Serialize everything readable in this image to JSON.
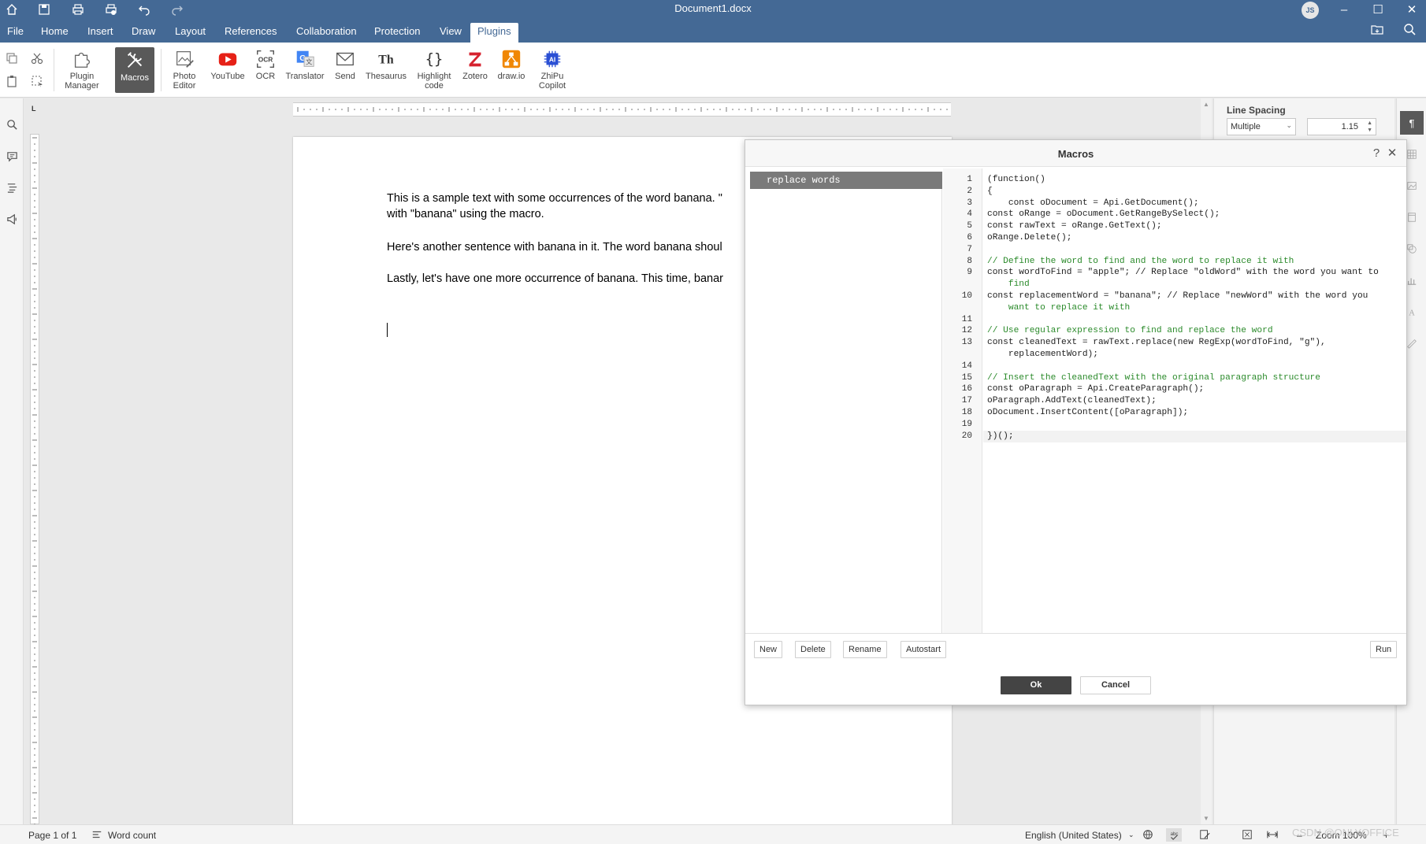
{
  "title_bar": {
    "document_title": "Document1.docx",
    "user_initials": "JS",
    "icons": [
      "home-icon",
      "save-icon",
      "print-icon",
      "quick-print-icon",
      "undo-icon",
      "redo-icon"
    ]
  },
  "menu": {
    "tabs": [
      "File",
      "Home",
      "Insert",
      "Draw",
      "Layout",
      "References",
      "Collaboration",
      "Protection",
      "View",
      "Plugins"
    ],
    "active_tab": "Plugins"
  },
  "toolbar": {
    "plugin_manager": "Plugin Manager",
    "macros": "Macros",
    "photo_editor": "Photo Editor",
    "youtube": "YouTube",
    "ocr": "OCR",
    "translator": "Translator",
    "send": "Send",
    "thesaurus": "Thesaurus",
    "highlight_code": "Highlight code",
    "zotero": "Zotero",
    "drawio": "draw.io",
    "zhipu_copilot": "ZhiPu Copilot"
  },
  "document": {
    "paragraphs": [
      "This is a sample text with some occurrences of the word  banana. \"",
      "with \"banana\" using the macro.",
      "Here's another sentence with banana in it. The word banana shoul",
      "Lastly, let's have one more occurrence of banana. This time, banar"
    ]
  },
  "right_panel": {
    "line_spacing_label": "Line Spacing",
    "line_spacing_mode": "Multiple",
    "line_spacing_value": "1.15"
  },
  "dialog": {
    "title": "Macros",
    "help_glyph": "?",
    "close_glyph": "✕",
    "macros": [
      "replace words"
    ],
    "code_lines": [
      {
        "n": "1",
        "text": "(function()",
        "type": "code"
      },
      {
        "n": "2",
        "text": "{",
        "type": "code"
      },
      {
        "n": "3",
        "text": "    const oDocument = Api.GetDocument();",
        "type": "code"
      },
      {
        "n": "4",
        "text": "const oRange = oDocument.GetRangeBySelect();",
        "type": "code"
      },
      {
        "n": "5",
        "text": "const rawText = oRange.GetText();",
        "type": "code"
      },
      {
        "n": "6",
        "text": "oRange.Delete();",
        "type": "code"
      },
      {
        "n": "7",
        "text": "",
        "type": "code"
      },
      {
        "n": "8",
        "text": "// Define the word to find and the word to replace it with",
        "type": "comment"
      },
      {
        "n": "9",
        "text": "const wordToFind = \"apple\"; // Replace \"oldWord\" with the word you want to",
        "type": "code"
      },
      {
        "n": "",
        "text": "    find",
        "type": "comment"
      },
      {
        "n": "10",
        "text": "const replacementWord = \"banana\"; // Replace \"newWord\" with the word you",
        "type": "code"
      },
      {
        "n": "",
        "text": "    want to replace it with",
        "type": "comment"
      },
      {
        "n": "11",
        "text": "",
        "type": "code"
      },
      {
        "n": "12",
        "text": "// Use regular expression to find and replace the word",
        "type": "comment"
      },
      {
        "n": "13",
        "text": "const cleanedText = rawText.replace(new RegExp(wordToFind, \"g\"),",
        "type": "code"
      },
      {
        "n": "",
        "text": "    replacementWord);",
        "type": "code"
      },
      {
        "n": "14",
        "text": "",
        "type": "code"
      },
      {
        "n": "15",
        "text": "// Insert the cleanedText with the original paragraph structure",
        "type": "comment"
      },
      {
        "n": "16",
        "text": "const oParagraph = Api.CreateParagraph();",
        "type": "code"
      },
      {
        "n": "17",
        "text": "oParagraph.AddText(cleanedText);",
        "type": "code"
      },
      {
        "n": "18",
        "text": "oDocument.InsertContent([oParagraph]);",
        "type": "code"
      },
      {
        "n": "19",
        "text": "",
        "type": "code"
      },
      {
        "n": "20",
        "text": "})();",
        "type": "code"
      }
    ],
    "buttons": {
      "new": "New",
      "delete": "Delete",
      "rename": "Rename",
      "autostart": "Autostart",
      "run": "Run",
      "ok": "Ok",
      "cancel": "Cancel"
    }
  },
  "status_bar": {
    "page": "Page 1 of 1",
    "word_count": "Word count",
    "language": "English (United States)",
    "zoom": "Zoom 100%"
  },
  "watermark": "CSDN @ONLYOFFICE",
  "colors": {
    "header_blue": "#446995",
    "active_button": "#595959",
    "comment_green": "#2a8a2a"
  }
}
